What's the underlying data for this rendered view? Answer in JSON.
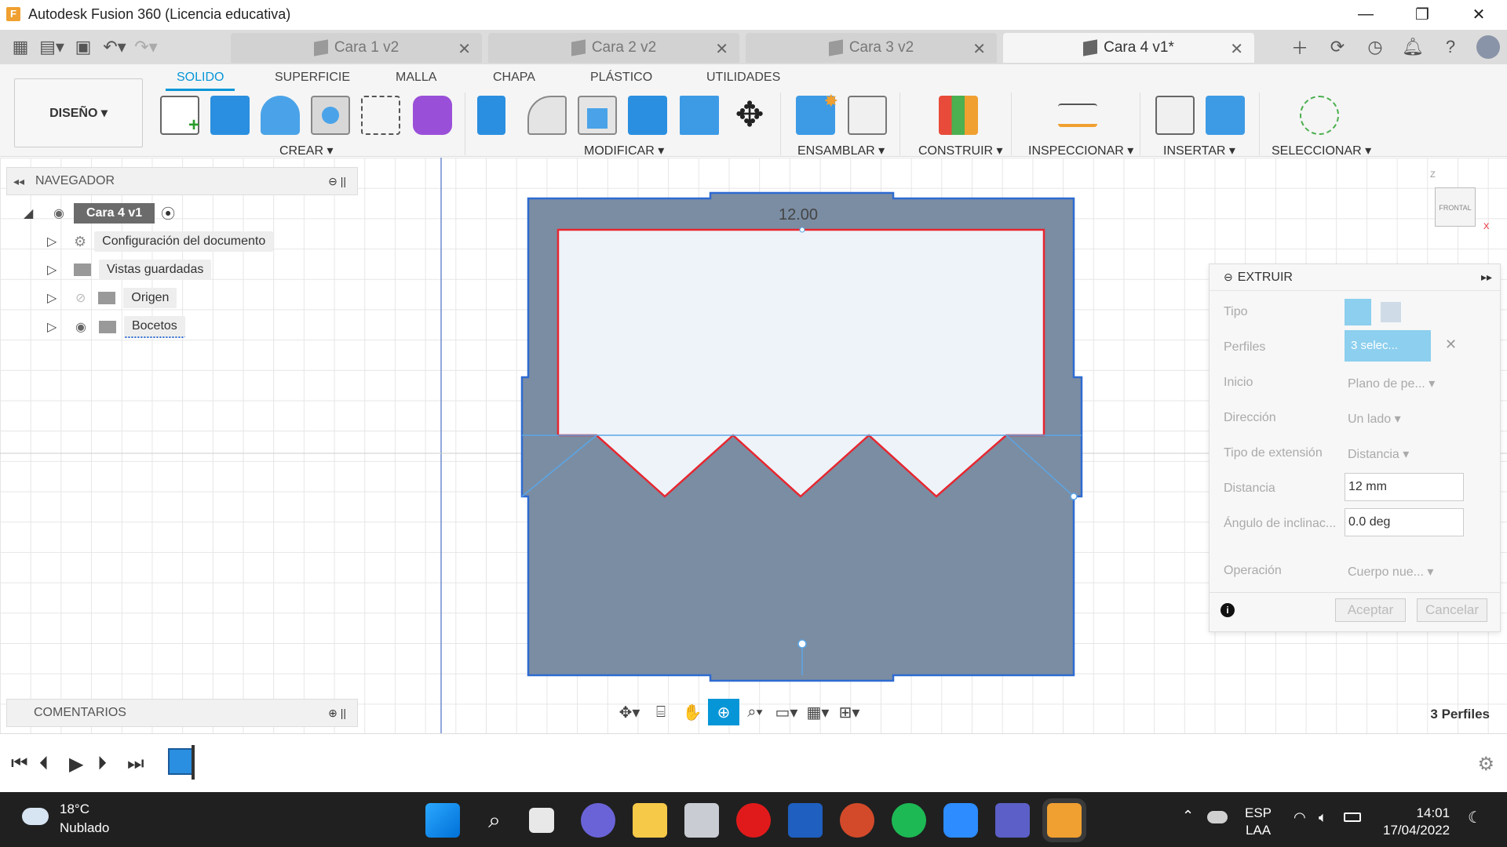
{
  "window": {
    "title": "Autodesk Fusion 360 (Licencia educativa)",
    "app_icon": "F",
    "min": "—",
    "max": "❐",
    "close": "✕"
  },
  "tabs": [
    {
      "label": "Cara 1 v2"
    },
    {
      "label": "Cara 2 v2"
    },
    {
      "label": "Cara 3 v2"
    },
    {
      "label": "Cara 4 v1*"
    }
  ],
  "ribbon": {
    "mode": "DISEÑO ▾",
    "tabs": [
      "SOLIDO",
      "SUPERFICIE",
      "MALLA",
      "CHAPA",
      "PLÁSTICO",
      "UTILIDADES"
    ],
    "groups": [
      "CREAR ▾",
      "MODIFICAR ▾",
      "ENSAMBLAR ▾",
      "CONSTRUIR ▾",
      "INSPECCIONAR ▾",
      "INSERTAR ▾",
      "SELECCIONAR ▾"
    ]
  },
  "navigator": {
    "title": "NAVEGADOR",
    "root": "Cara 4 v1",
    "items": [
      "Configuración del documento",
      "Vistas guardadas",
      "Origen",
      "Bocetos"
    ]
  },
  "sketch": {
    "dimension": "12.00"
  },
  "viewcube": {
    "face": "FRONTAL",
    "z": "Z",
    "x": "X"
  },
  "extrude": {
    "title": "EXTRUIR",
    "rows": [
      {
        "label": "Tipo",
        "value": ""
      },
      {
        "label": "Perfiles",
        "value": "3 selec..."
      },
      {
        "label": "Inicio",
        "value": "Plano de pe... ▾"
      },
      {
        "label": "Dirección",
        "value": "Un lado ▾"
      },
      {
        "label": "Tipo de extensión",
        "value": "Distancia ▾"
      },
      {
        "label": "Distancia",
        "value": "12 mm"
      },
      {
        "label": "Ángulo de inclinac...",
        "value": "0.0 deg"
      },
      {
        "label": "Operación",
        "value": "Cuerpo nue... ▾"
      }
    ],
    "ok": "Aceptar",
    "cancel": "Cancelar"
  },
  "comments": {
    "title": "COMENTARIOS"
  },
  "status": {
    "profiles": "3 Perfiles"
  },
  "taskbar": {
    "temp": "18°C",
    "weather": "Nublado",
    "lang1": "ESP",
    "lang2": "LAA",
    "time": "14:01",
    "date": "17/04/2022"
  },
  "colors": {
    "accent": "#0696d7",
    "body": "#7b8da3",
    "sketch_red": "#e8262f"
  }
}
